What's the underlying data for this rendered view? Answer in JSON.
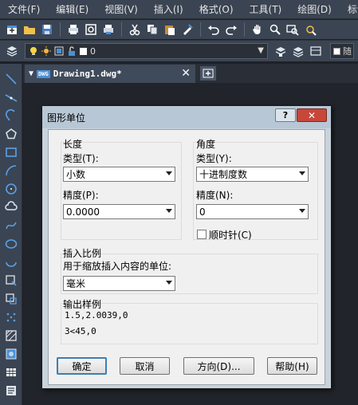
{
  "menu": [
    "文件(F)",
    "编辑(E)",
    "视图(V)",
    "插入(I)",
    "格式(O)",
    "工具(T)",
    "绘图(D)",
    "标注"
  ],
  "layer_bar": {
    "current_layer": "0",
    "extra_label": "随"
  },
  "tab": {
    "title": "Drawing1.dwg*",
    "close": "✕",
    "file_icon_label": "DWG"
  },
  "dialog": {
    "title": "图形单位",
    "help_btn": "?",
    "close_btn": "✕",
    "length": {
      "group_label": "长度",
      "type_label": "类型(T):",
      "type_value": "小数",
      "precision_label": "精度(P):",
      "precision_value": "0.0000"
    },
    "angle": {
      "group_label": "角度",
      "type_label": "类型(Y):",
      "type_value": "十进制度数",
      "precision_label": "精度(N):",
      "precision_value": "0",
      "clockwise_label": "顺时针(C)",
      "clockwise_checked": false
    },
    "insertion": {
      "group_label": "插入比例",
      "units_label": "用于缩放插入内容的单位:",
      "units_value": "毫米"
    },
    "sample": {
      "group_label": "输出样例",
      "line1": "1.5,2.0039,0",
      "line2": "3<45,0"
    },
    "buttons": {
      "ok": "确定",
      "cancel": "取消",
      "direction": "方向(D)...",
      "help": "帮助(H)"
    }
  },
  "colors": {
    "ui_bg": "#3b4452",
    "canvas_bg": "#21252b",
    "dialog_frame": "#c9d3dc",
    "close_red": "#c7473a"
  }
}
